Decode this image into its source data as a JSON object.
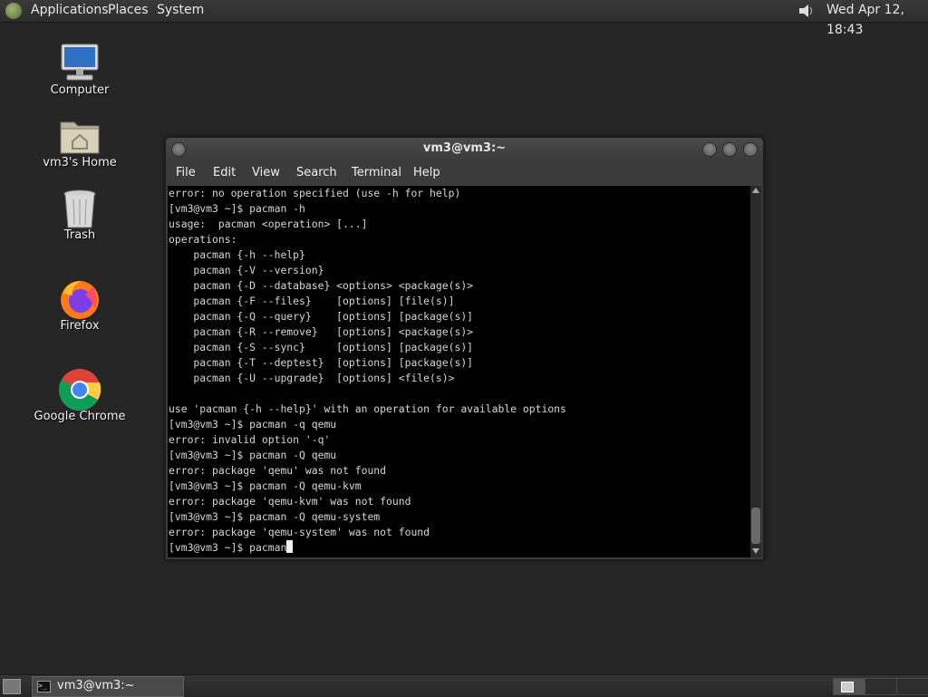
{
  "top_panel": {
    "menus": [
      "Applications",
      "Places",
      "System"
    ],
    "clock": "Wed Apr 12, 18:43"
  },
  "desktop_icons": [
    {
      "label": "Computer"
    },
    {
      "label": "vm3's Home"
    },
    {
      "label": "Trash"
    },
    {
      "label": "Firefox"
    },
    {
      "label": "Google Chrome"
    }
  ],
  "terminal": {
    "title": "vm3@vm3:~",
    "menu": [
      "File",
      "Edit",
      "View",
      "Search",
      "Terminal",
      "Help"
    ],
    "lines": [
      "error: no operation specified (use -h for help)",
      "[vm3@vm3 ~]$ pacman -h",
      "usage:  pacman <operation> [...]",
      "operations:",
      "    pacman {-h --help}",
      "    pacman {-V --version}",
      "    pacman {-D --database} <options> <package(s)>",
      "    pacman {-F --files}    [options] [file(s)]",
      "    pacman {-Q --query}    [options] [package(s)]",
      "    pacman {-R --remove}   [options] <package(s)>",
      "    pacman {-S --sync}     [options] [package(s)]",
      "    pacman {-T --deptest}  [options] [package(s)]",
      "    pacman {-U --upgrade}  [options] <file(s)>",
      "",
      "use 'pacman {-h --help}' with an operation for available options",
      "[vm3@vm3 ~]$ pacman -q qemu",
      "error: invalid option '-q'",
      "[vm3@vm3 ~]$ pacman -Q qemu",
      "error: package 'qemu' was not found",
      "[vm3@vm3 ~]$ pacman -Q qemu-kvm",
      "error: package 'qemu-kvm' was not found",
      "[vm3@vm3 ~]$ pacman -Q qemu-system",
      "error: package 'qemu-system' was not found"
    ],
    "current_input": "[vm3@vm3 ~]$ pacman"
  },
  "bottom_panel": {
    "taskbar_item": "vm3@vm3:~"
  },
  "colors": {
    "desktop_bg": "#262626",
    "terminal_bg": "#000000",
    "terminal_fg": "#d6d6d6"
  }
}
